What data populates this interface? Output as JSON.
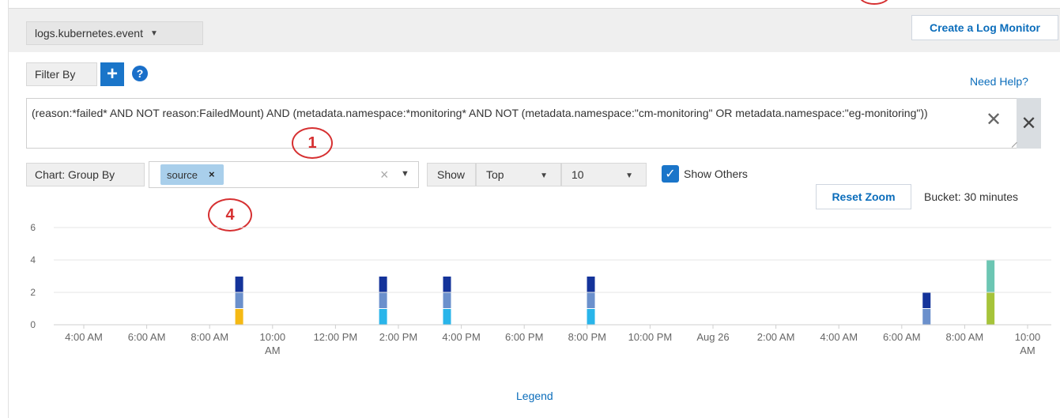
{
  "source_select": {
    "value": "logs.kubernetes.event"
  },
  "create_monitor_label": "Create a Log Monitor",
  "filter": {
    "label": "Filter By",
    "add_label": "+",
    "help_label": "?",
    "need_help": "Need Help?"
  },
  "query": {
    "text": "(reason:*failed* AND NOT reason:FailedMount) AND (metadata.namespace:*monitoring* AND NOT (metadata.namespace:\"cm-monitoring\" OR metadata.namespace:\"eg-monitoring\"))",
    "clear_label": "✕",
    "close_label": "✕"
  },
  "annotations": {
    "a1": "1",
    "a4": "4"
  },
  "group_by": {
    "label": "Chart: Group By",
    "chip": "source",
    "chip_remove": "×",
    "clear": "×"
  },
  "show": {
    "label": "Show",
    "order": "Top",
    "count": "10"
  },
  "show_others": {
    "checked": true,
    "label": "Show Others"
  },
  "reset_zoom_label": "Reset Zoom",
  "bucket_label": "Bucket: 30 minutes",
  "legend_label": "Legend",
  "colors": {
    "accent": "#1a75c9",
    "link": "#0b6dbb",
    "annotation": "#d63031"
  },
  "chart_data": {
    "type": "bar",
    "stacked": true,
    "grid": true,
    "ylim": [
      0,
      6
    ],
    "y_ticks": [
      "0",
      "2",
      "4",
      "6"
    ],
    "x_ticks": [
      "4:00 AM",
      "6:00 AM",
      "8:00 AM",
      "10:00 AM",
      "12:00 PM",
      "2:00 PM",
      "4:00 PM",
      "6:00 PM",
      "8:00 PM",
      "10:00 PM",
      "Aug 26",
      "2:00 AM",
      "4:00 AM",
      "6:00 AM",
      "8:00 AM",
      "10:00 AM"
    ],
    "x_range_hours": [
      3,
      34.2
    ],
    "bars": [
      {
        "t_hours": 8.8,
        "segments": [
          {
            "value": 1,
            "color": "#f5b914"
          },
          {
            "value": 1,
            "color": "#6b90cc"
          },
          {
            "value": 1,
            "color": "#14339a"
          }
        ]
      },
      {
        "t_hours": 13.3,
        "segments": [
          {
            "value": 1,
            "color": "#29b5ea"
          },
          {
            "value": 1,
            "color": "#6b90cc"
          },
          {
            "value": 1,
            "color": "#14339a"
          }
        ]
      },
      {
        "t_hours": 15.3,
        "segments": [
          {
            "value": 1,
            "color": "#29b5ea"
          },
          {
            "value": 1,
            "color": "#6b90cc"
          },
          {
            "value": 1,
            "color": "#14339a"
          }
        ]
      },
      {
        "t_hours": 19.8,
        "segments": [
          {
            "value": 1,
            "color": "#29b5ea"
          },
          {
            "value": 1,
            "color": "#6b90cc"
          },
          {
            "value": 1,
            "color": "#14339a"
          }
        ]
      },
      {
        "t_hours": 30.3,
        "segments": [
          {
            "value": 1,
            "color": "#6b90cc"
          },
          {
            "value": 1,
            "color": "#14339a"
          }
        ]
      },
      {
        "t_hours": 32.3,
        "segments": [
          {
            "value": 2,
            "color": "#a6c43a"
          },
          {
            "value": 2,
            "color": "#6cc6b3"
          }
        ]
      }
    ]
  }
}
